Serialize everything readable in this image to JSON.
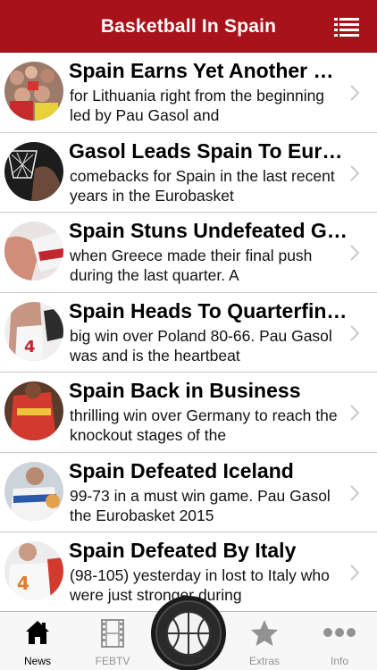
{
  "header": {
    "title": "Basketball In Spain"
  },
  "articles": [
    {
      "title": "Spain Earns Yet Another Win",
      "snippet": "for Lithuania right from the beginning led by Pau Gasol and"
    },
    {
      "title": "Gasol Leads Spain To Eurobasket",
      "snippet": "comebacks for Spain in the last recent years in the Eurobasket"
    },
    {
      "title": "Spain Stuns Undefeated Greece",
      "snippet": "when Greece made their final push during the last quarter. A"
    },
    {
      "title": "Spain Heads To Quarterfinals",
      "snippet": "big win over Poland 80-66. Pau Gasol was and is the heartbeat"
    },
    {
      "title": "Spain Back in Business",
      "snippet": "thrilling win over Germany to reach the knockout stages of the"
    },
    {
      "title": "Spain Defeated Iceland",
      "snippet": "99-73 in a must win game. Pau Gasol the Eurobasket 2015"
    },
    {
      "title": "Spain Defeated By Italy",
      "snippet": "(98-105) yesterday in lost to Italy who were just stronger during"
    }
  ],
  "tabs": [
    {
      "label": "News",
      "icon": "house-icon"
    },
    {
      "label": "FEBTV",
      "icon": "film-icon"
    },
    {
      "label": "Extras",
      "icon": "star-icon"
    },
    {
      "label": "Info",
      "icon": "more-icon"
    }
  ],
  "center_button": {
    "icon": "basketball-icon"
  },
  "colors": {
    "brand": "#a8121a",
    "tab_active": "#000000",
    "tab_inactive": "#929292"
  }
}
